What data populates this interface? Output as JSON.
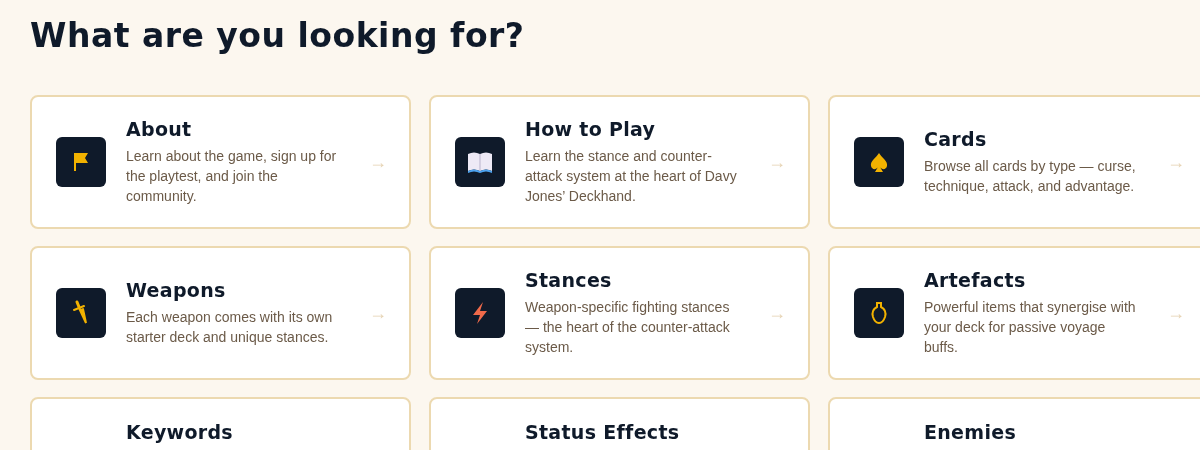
{
  "heading": "What are you looking for?",
  "cards": [
    {
      "kind": "flag",
      "title": "About",
      "description": "Learn about the game, sign up for the playtest, and join the community.",
      "arrow": "→"
    },
    {
      "kind": "book",
      "title": "How to Play",
      "description": "Learn the stance and counter-attack system at the heart of Davy Jones’ Deckhand.",
      "arrow": "→"
    },
    {
      "kind": "spade",
      "title": "Cards",
      "description": "Browse all cards by type — curse, technique, attack, and advantage.",
      "arrow": "→"
    },
    {
      "kind": "dagger",
      "title": "Weapons",
      "description": "Each weapon comes with its own starter deck and unique stances.",
      "arrow": "→"
    },
    {
      "kind": "bolt",
      "title": "Stances",
      "description": "Weapon-specific fighting stances — the heart of the counter-attack system.",
      "arrow": "→"
    },
    {
      "kind": "vase",
      "title": "Artefacts",
      "description": "Powerful items that synergise with your deck for passive voyage buffs.",
      "arrow": "→"
    },
    {
      "title": "Keywords"
    },
    {
      "title": "Status Effects"
    },
    {
      "title": "Enemies"
    }
  ]
}
